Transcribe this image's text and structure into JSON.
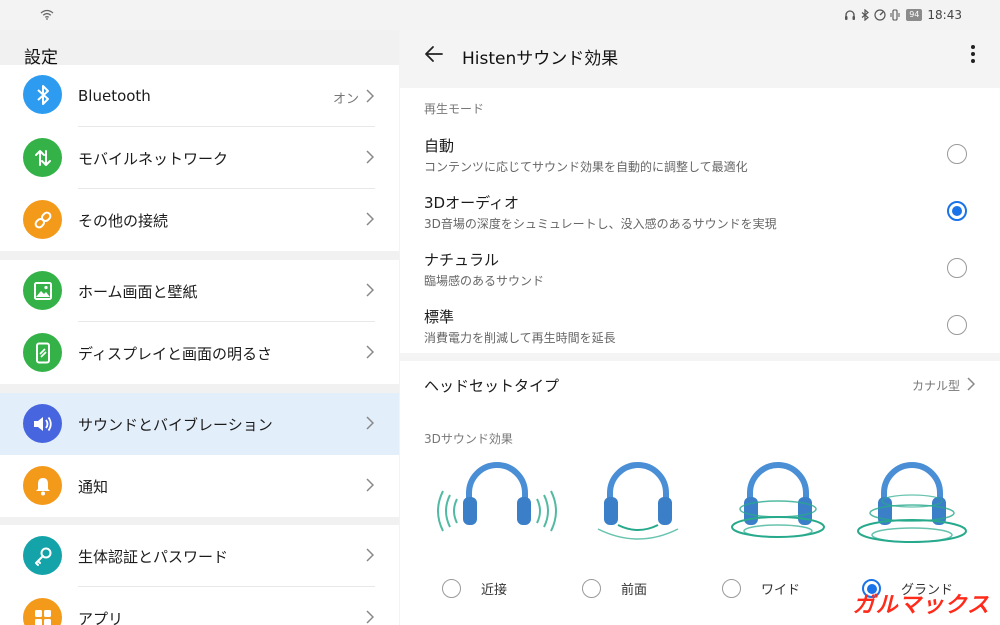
{
  "status": {
    "time": "18:43",
    "battery": "94"
  },
  "sidebar": {
    "title": "設定",
    "items": [
      {
        "label": "Bluetooth",
        "value": "オン",
        "icon": "bluetooth-icon",
        "color": "#2d9cf0"
      },
      {
        "label": "モバイルネットワーク",
        "icon": "mobile-network-icon",
        "color": "#34b248"
      },
      {
        "label": "その他の接続",
        "icon": "link-icon",
        "color": "#f39a1b"
      },
      {
        "label": "ホーム画面と壁紙",
        "icon": "wallpaper-icon",
        "color": "#34b248"
      },
      {
        "label": "ディスプレイと画面の明るさ",
        "icon": "display-icon",
        "color": "#34b248"
      },
      {
        "label": "サウンドとバイブレーション",
        "icon": "sound-icon",
        "color": "#4865e0"
      },
      {
        "label": "通知",
        "icon": "bell-icon",
        "color": "#f39a1b"
      },
      {
        "label": "生体認証とパスワード",
        "icon": "key-icon",
        "color": "#14a3a8"
      },
      {
        "label": "アプリ",
        "icon": "apps-icon",
        "color": "#f39a1b"
      }
    ]
  },
  "main": {
    "title": "Histenサウンド効果",
    "playback_section": "再生モード",
    "modes": [
      {
        "title": "自動",
        "desc": "コンテンツに応じてサウンド効果を自動的に調整して最適化",
        "selected": false
      },
      {
        "title": "3Dオーディオ",
        "desc": "3D音場の深度をシュミュレートし、没入感のあるサウンドを実現",
        "selected": true
      },
      {
        "title": "ナチュラル",
        "desc": "臨場感のあるサウンド",
        "selected": false
      },
      {
        "title": "標準",
        "desc": "消費電力を削減して再生時間を延長",
        "selected": false
      }
    ],
    "headset_label": "ヘッドセットタイプ",
    "headset_value": "カナル型",
    "effect_section": "3Dサウンド効果",
    "effects": [
      {
        "label": "近接",
        "selected": false
      },
      {
        "label": "前面",
        "selected": false
      },
      {
        "label": "ワイド",
        "selected": false
      },
      {
        "label": "グランド",
        "selected": true
      }
    ]
  },
  "colors": {
    "accent": "#1a73e8",
    "active_bg": "#e3eefb",
    "headphone": "#4a8fd6",
    "wave": "#27a98c"
  },
  "watermark": "ガルマックス"
}
